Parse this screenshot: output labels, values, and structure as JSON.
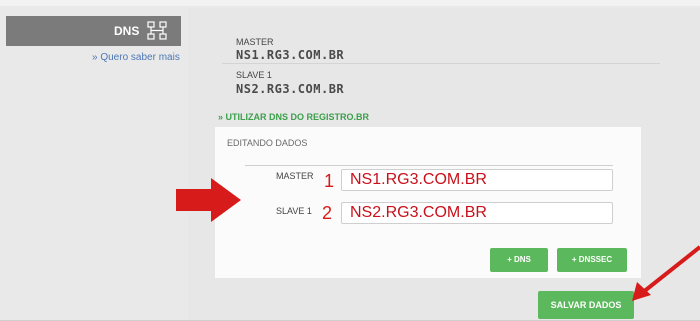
{
  "sidebar": {
    "dns_label": "DNS",
    "help_link": "» Quero saber mais"
  },
  "current": {
    "master_label": "MASTER",
    "master_value": "NS1.RG3.COM.BR",
    "slave_label": "SLAVE 1",
    "slave_value": "NS2.RG3.COM.BR"
  },
  "registro_link": "» UTILIZAR DNS DO REGISTRO.BR",
  "editor": {
    "title": "EDITANDO DADOS",
    "master_label": "MASTER",
    "master_number": "1",
    "master_input": "NS1.RG3.COM.BR",
    "slave_label": "SLAVE 1",
    "slave_number": "2",
    "slave_input": "NS2.RG3.COM.BR",
    "add_dns_button": "+ DNS",
    "add_dnssec_button": "+ DNSSEC"
  },
  "save_button": "SALVAR DADOS",
  "colors": {
    "accent_green": "#5cb85c",
    "arrow_red": "#d71a1a",
    "link_blue": "#4c77b7"
  },
  "icons": {
    "dns_tab": "network-icon",
    "annotation_left": "arrow-right-annotation",
    "annotation_save": "arrow-annotation"
  }
}
